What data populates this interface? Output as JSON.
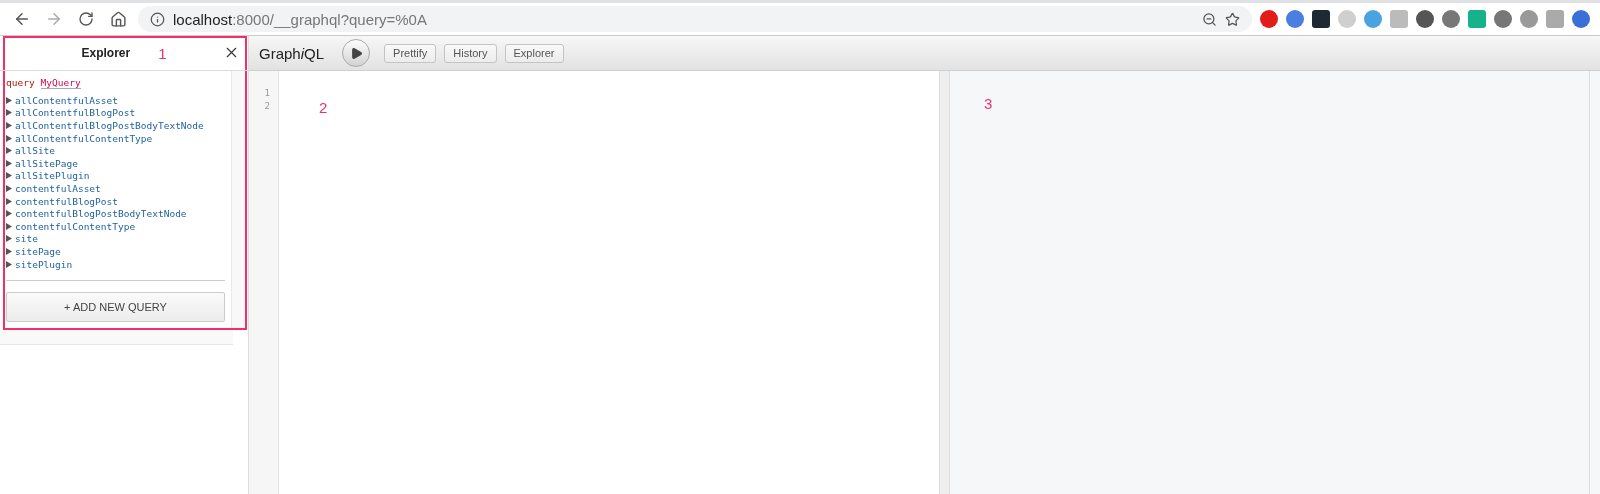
{
  "browser": {
    "url_host": "localhost",
    "url_rest": ":8000/__graphql?query=%0A"
  },
  "explorer": {
    "title": "Explorer",
    "query_keyword": "query",
    "query_name": "MyQuery",
    "fields": [
      "allContentfulAsset",
      "allContentfulBlogPost",
      "allContentfulBlogPostBodyTextNode",
      "allContentfulContentType",
      "allSite",
      "allSitePage",
      "allSitePlugin",
      "contentfulAsset",
      "contentfulBlogPost",
      "contentfulBlogPostBodyTextNode",
      "contentfulContentType",
      "site",
      "sitePage",
      "sitePlugin"
    ],
    "add_button": "+ ADD NEW QUERY"
  },
  "toolbar": {
    "title_start": "Graph",
    "title_italic": "i",
    "title_end": "QL",
    "buttons": [
      "Prettify",
      "History",
      "Explorer"
    ]
  },
  "editor": {
    "line_numbers": [
      "1",
      "2"
    ]
  },
  "annotations": [
    "1",
    "2",
    "3"
  ]
}
